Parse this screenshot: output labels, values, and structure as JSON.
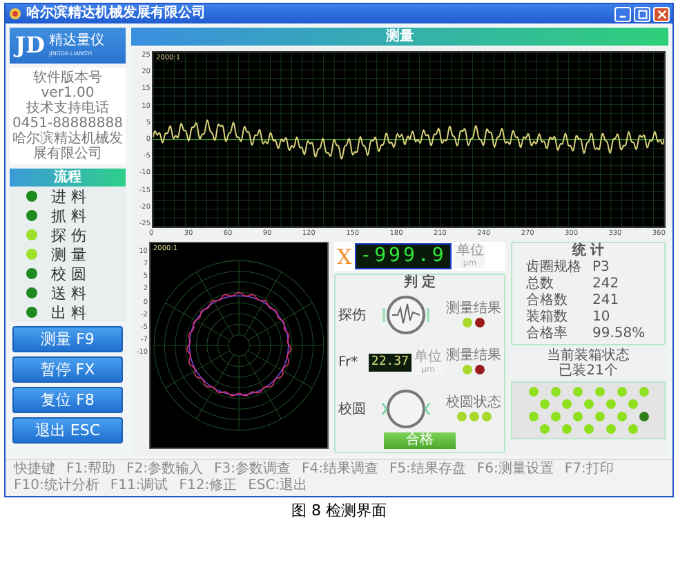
{
  "window": {
    "title": "哈尔滨精达机械发展有限公司"
  },
  "logo": {
    "mark": "JD",
    "name": "精达量仪",
    "subtitle": "JINGDA LIANGYI"
  },
  "info": [
    "软件版本号",
    "ver1.00",
    "技术支持电话",
    "0451-88888888",
    "哈尔滨精达机械发展有限公司"
  ],
  "process": {
    "title": "流程",
    "steps": [
      {
        "label": "进 料",
        "on": false
      },
      {
        "label": "抓 料",
        "on": false
      },
      {
        "label": "探 伤",
        "on": true
      },
      {
        "label": "测 量",
        "on": true
      },
      {
        "label": "校 圆",
        "on": false
      },
      {
        "label": "送 料",
        "on": false
      },
      {
        "label": "出 料",
        "on": false
      }
    ]
  },
  "buttons": [
    "测量 F9",
    "暂停 FX",
    "复位 F8",
    "退出 ESC"
  ],
  "header": "测量",
  "wave_chart": {
    "scale": "2000:1",
    "y_labels": [
      "25",
      "20",
      "15",
      "10",
      "5",
      "0",
      "-5",
      "-10",
      "-15",
      "-20",
      "-25"
    ],
    "x_labels": [
      "0",
      "30",
      "60",
      "90",
      "120",
      "150",
      "180",
      "210",
      "240",
      "270",
      "300",
      "330",
      "360"
    ]
  },
  "polar_chart": {
    "scale": "2000:1",
    "y_labels": [
      "10",
      "7",
      "5",
      "2",
      "0",
      "-2",
      "-5",
      "-7",
      "-10"
    ]
  },
  "reading": {
    "axis": "X",
    "value": "-999.9",
    "unit_label": "单位",
    "unit": "μm"
  },
  "judgement": {
    "title": "判 定",
    "rows": [
      {
        "kind": "wave",
        "label": "探伤",
        "lamp_label": "测量结果",
        "lamps": [
          {
            "color": "#a8d82c"
          },
          {
            "color": "#9a1c1c"
          }
        ]
      },
      {
        "kind": "display",
        "label": "Fr*",
        "value": "22.37",
        "unit_label": "单位",
        "unit": "μm",
        "lamp_label": "测量结果",
        "lamps": [
          {
            "color": "#a8d82c"
          },
          {
            "color": "#9a1c1c"
          }
        ]
      },
      {
        "kind": "ring",
        "label": "校圆",
        "lamp_label": "校圆状态",
        "lamps": [
          {
            "color": "#a8d82c"
          },
          {
            "color": "#a8d82c"
          },
          {
            "color": "#a8d82c"
          }
        ]
      }
    ],
    "result": "合格"
  },
  "stats": {
    "title": "统 计",
    "rows": [
      {
        "label": "齿圈规格",
        "value": "P3"
      },
      {
        "label": "总数",
        "value": "242"
      },
      {
        "label": "合格数",
        "value": "241"
      },
      {
        "label": "装箱数",
        "value": "10"
      },
      {
        "label": "合格率",
        "value": "99.58%"
      }
    ]
  },
  "box": {
    "title": "当前装箱状态",
    "count": "已装21个",
    "slots": [
      {
        "filled": true
      },
      {
        "filled": true
      },
      {
        "filled": true
      },
      {
        "filled": true
      },
      {
        "filled": true
      },
      {
        "filled": true
      },
      {
        "filled": true
      },
      {
        "filled": true
      },
      {
        "filled": true
      },
      {
        "filled": true
      },
      {
        "filled": true
      },
      {
        "filled": true
      },
      {
        "filled": true
      },
      {
        "filled": true
      },
      {
        "filled": true
      },
      {
        "filled": true
      },
      {
        "filled": false
      },
      {
        "filled": true
      },
      {
        "filled": true
      },
      {
        "filled": true
      },
      {
        "filled": true
      },
      {
        "filled": true
      }
    ]
  },
  "shortcuts": [
    "快捷键",
    "F1:帮助",
    "F2:参数输入",
    "F3:参数调查",
    "F4:结果调查",
    "F5:结果存盘",
    "F6:测量设置",
    "F7:打印",
    "F10:统计分析",
    "F11:调试",
    "F12:修正",
    "ESC:退出"
  ],
  "caption": "图 8 检测界面"
}
